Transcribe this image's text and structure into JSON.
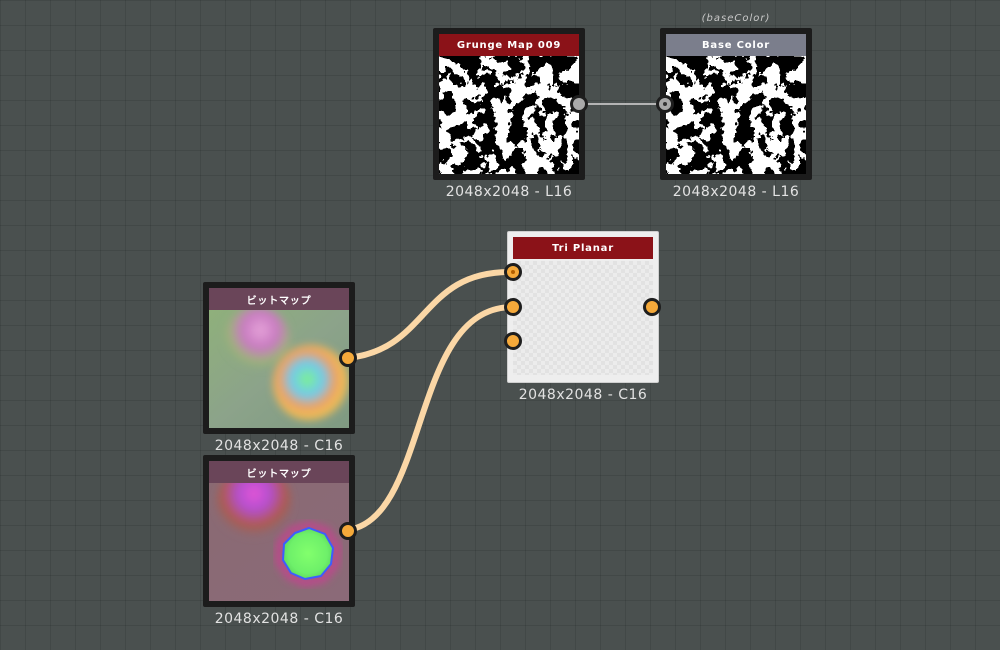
{
  "nodes": {
    "grunge": {
      "title": "Grunge Map 009",
      "caption": "2048x2048 - L16",
      "title_color": "#8b1218"
    },
    "basecolor": {
      "tag": "(baseColor)",
      "title": "Base Color",
      "caption": "2048x2048 - L16",
      "title_color": "#7b7e8c"
    },
    "bitmap1": {
      "title": "ビットマップ",
      "caption": "2048x2048 - C16",
      "title_color": "#6a4559"
    },
    "bitmap2": {
      "title": "ビットマップ",
      "caption": "2048x2048 - C16",
      "title_color": "#6a4559"
    },
    "triplanar": {
      "title": "Tri Planar",
      "caption": "2048x2048 - C16",
      "title_color": "#8b1218"
    }
  },
  "colors": {
    "background": "#4a504f",
    "wire_color": "#fbd7a6",
    "wire_gray": "#b4b4b4",
    "port_orange": "#f5a93a",
    "port_gray": "#a9a9a9"
  },
  "icons": {
    "output_port": "circle-port",
    "input_port": "circle-port"
  }
}
